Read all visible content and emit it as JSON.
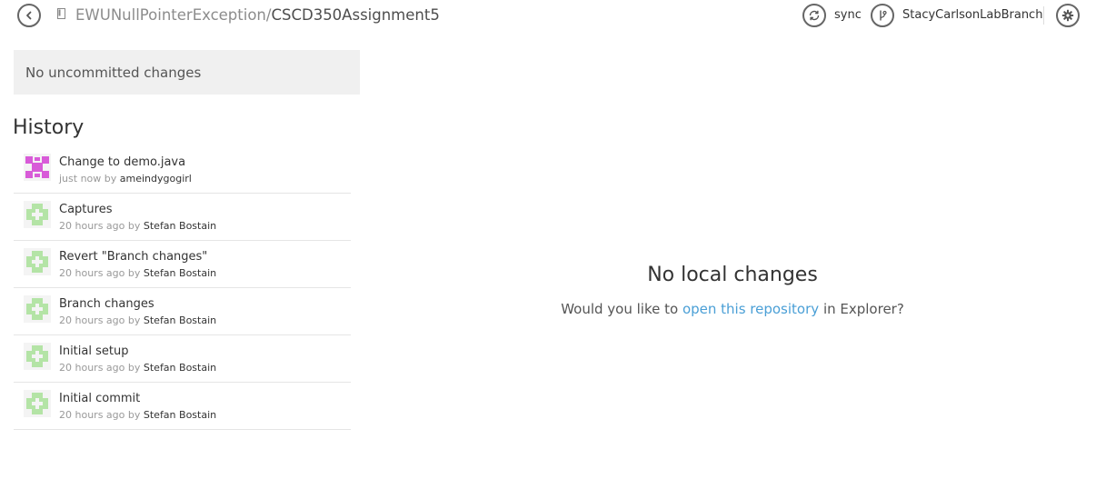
{
  "header": {
    "back_icon": "chevron-left-icon",
    "repo_icon": "repository-icon",
    "repo_owner": "EWUNullPointerException",
    "repo_separator": "/",
    "repo_name": "CSCD350Assignment5",
    "sync_icon": "sync-icon",
    "sync_label": "sync",
    "branch_icon": "branch-icon",
    "branch_label": "StacyCarlsonLabBranch",
    "settings_icon": "gear-icon"
  },
  "sidebar": {
    "uncommitted_label": "No uncommitted changes",
    "history_title": "History",
    "history": [
      {
        "message": "Change to demo.java",
        "time": "just now",
        "by": "by",
        "author": "ameindygogirl",
        "avatar_color": "#d85bd8"
      },
      {
        "message": "Captures",
        "time": "20 hours ago",
        "by": "by",
        "author": "Stefan Bostain",
        "avatar_color": "#b4e4a6"
      },
      {
        "message": "Revert \"Branch changes\"",
        "time": "20 hours ago",
        "by": "by",
        "author": "Stefan Bostain",
        "avatar_color": "#b4e4a6"
      },
      {
        "message": "Branch changes",
        "time": "20 hours ago",
        "by": "by",
        "author": "Stefan Bostain",
        "avatar_color": "#b4e4a6"
      },
      {
        "message": "Initial setup",
        "time": "20 hours ago",
        "by": "by",
        "author": "Stefan Bostain",
        "avatar_color": "#b4e4a6"
      },
      {
        "message": "Initial commit",
        "time": "20 hours ago",
        "by": "by",
        "author": "Stefan Bostain",
        "avatar_color": "#b4e4a6"
      }
    ]
  },
  "main": {
    "empty_title": "No local changes",
    "prompt_before": "Would you like to",
    "prompt_link": "open this repository",
    "prompt_after": "in Explorer?"
  },
  "colors": {
    "link": "#4a9fd6",
    "panel_bg": "#f0f0f0"
  }
}
